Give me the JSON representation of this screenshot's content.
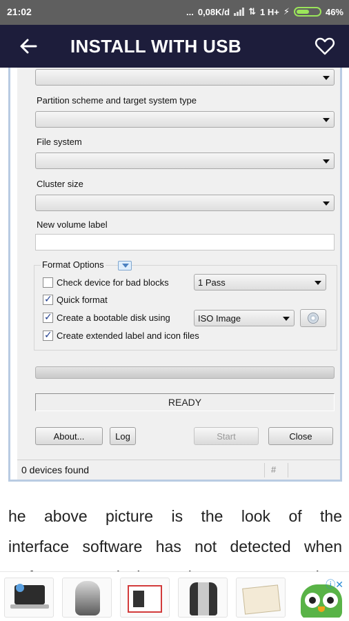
{
  "status_bar": {
    "time": "21:02",
    "dots": "...",
    "speed": "0,08K/d",
    "network": "1 H+",
    "battery": "46%"
  },
  "app_bar": {
    "title": "INSTALL WITH USB",
    "back_icon": "arrow-left-icon",
    "favorite_icon": "heart-outline-icon",
    "bar_color": "#1d1d3b"
  },
  "window": {
    "device_value": "",
    "partition_label": "Partition scheme and target system type",
    "partition_value": "",
    "filesystem_label": "File system",
    "filesystem_value": "",
    "cluster_label": "Cluster size",
    "cluster_value": "",
    "volume_label": "New volume label",
    "volume_value": "",
    "format_options": {
      "title": "Format Options",
      "bad_blocks": {
        "label": "Check device for bad blocks",
        "checked": false,
        "passes": "1 Pass"
      },
      "quick_format": {
        "label": "Quick format",
        "checked": true
      },
      "bootable": {
        "label": "Create a bootable disk using",
        "checked": true,
        "type": "ISO Image",
        "icon": "disc-icon"
      },
      "extended_label": {
        "label": "Create extended label and icon files",
        "checked": true
      }
    },
    "status_text": "READY",
    "buttons": {
      "about": "About...",
      "log": "Log",
      "start": "Start",
      "close": "Close"
    },
    "statusbar": {
      "devices": "0 devices found",
      "hash": "#"
    }
  },
  "article": {
    "line1": "he above picture is the look of the",
    "line2": "interface software has not detected when",
    "line3": "Rufus USB device Drive. However when"
  },
  "ads": {
    "info_icon": "ad-info-icon",
    "close_icon": "close-icon",
    "items": [
      "hp-laptop-ad",
      "scooter-ad",
      "usb-kit-ad",
      "jacket-ad",
      "document-ad",
      "owl-app-ad"
    ]
  }
}
